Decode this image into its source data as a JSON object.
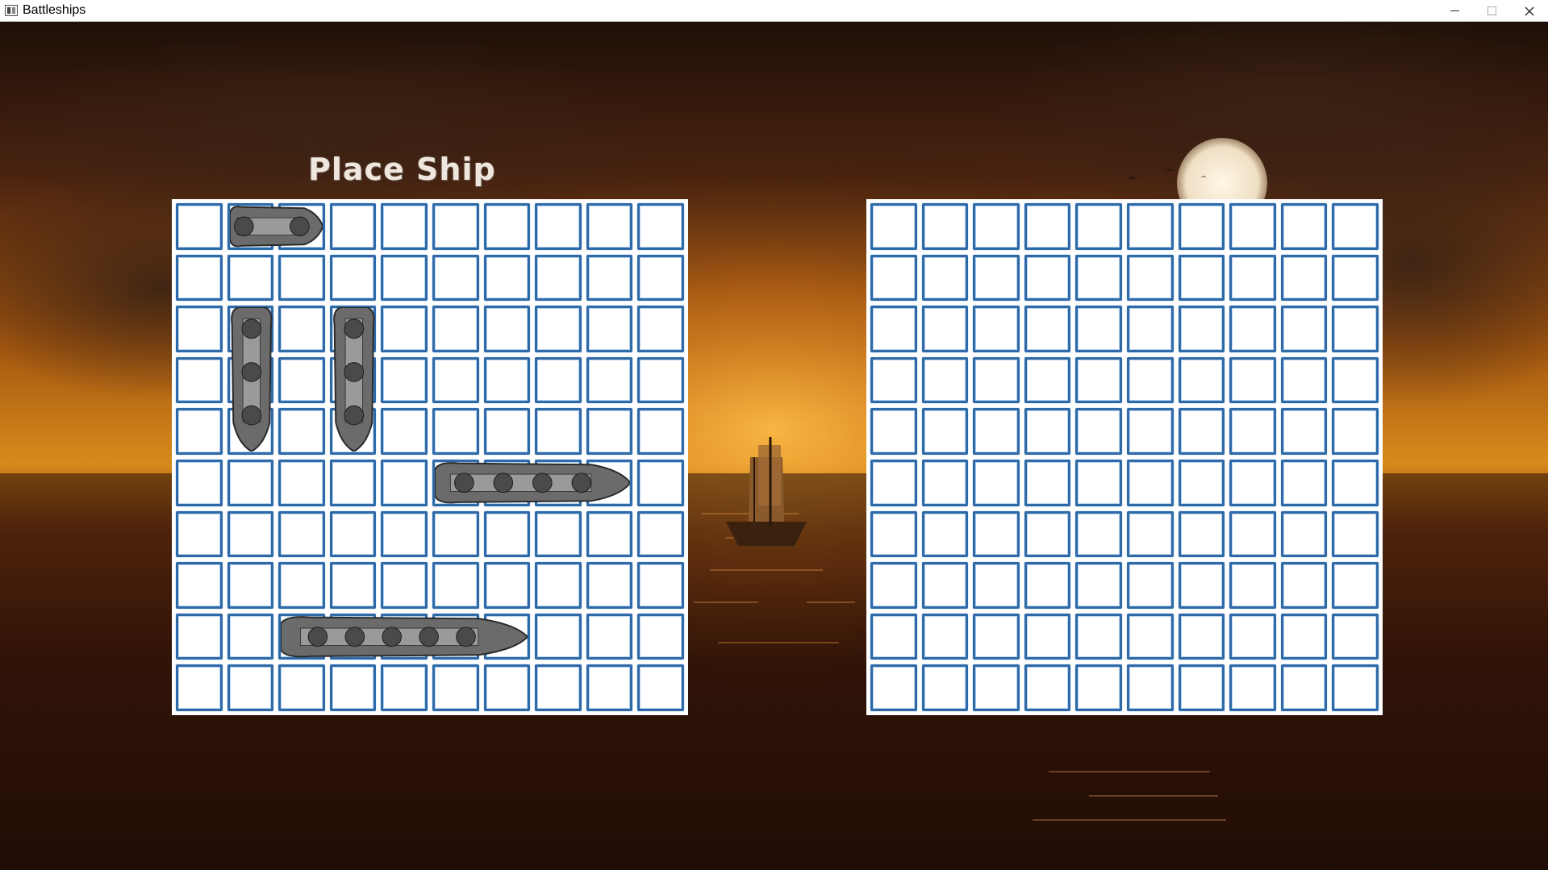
{
  "window": {
    "title": "Battleships"
  },
  "window_controls": [
    "minimize",
    "maximize",
    "close"
  ],
  "heading": "Place Ship",
  "colors": {
    "cell_border": "#2f6aa8",
    "board_background": "#ffffff",
    "heading_text": "#efe6dd"
  },
  "player_board": {
    "rows": 10,
    "cols": 10,
    "ships": [
      {
        "name": "patrol-boat",
        "row": 0,
        "col": 1,
        "length": 2,
        "orientation": "horizontal"
      },
      {
        "name": "destroyer",
        "row": 2,
        "col": 1,
        "length": 3,
        "orientation": "vertical"
      },
      {
        "name": "submarine",
        "row": 2,
        "col": 3,
        "length": 3,
        "orientation": "vertical"
      },
      {
        "name": "battleship",
        "row": 5,
        "col": 5,
        "length": 4,
        "orientation": "horizontal"
      },
      {
        "name": "carrier",
        "row": 8,
        "col": 2,
        "length": 5,
        "orientation": "horizontal"
      }
    ]
  },
  "enemy_board": {
    "rows": 10,
    "cols": 10
  }
}
